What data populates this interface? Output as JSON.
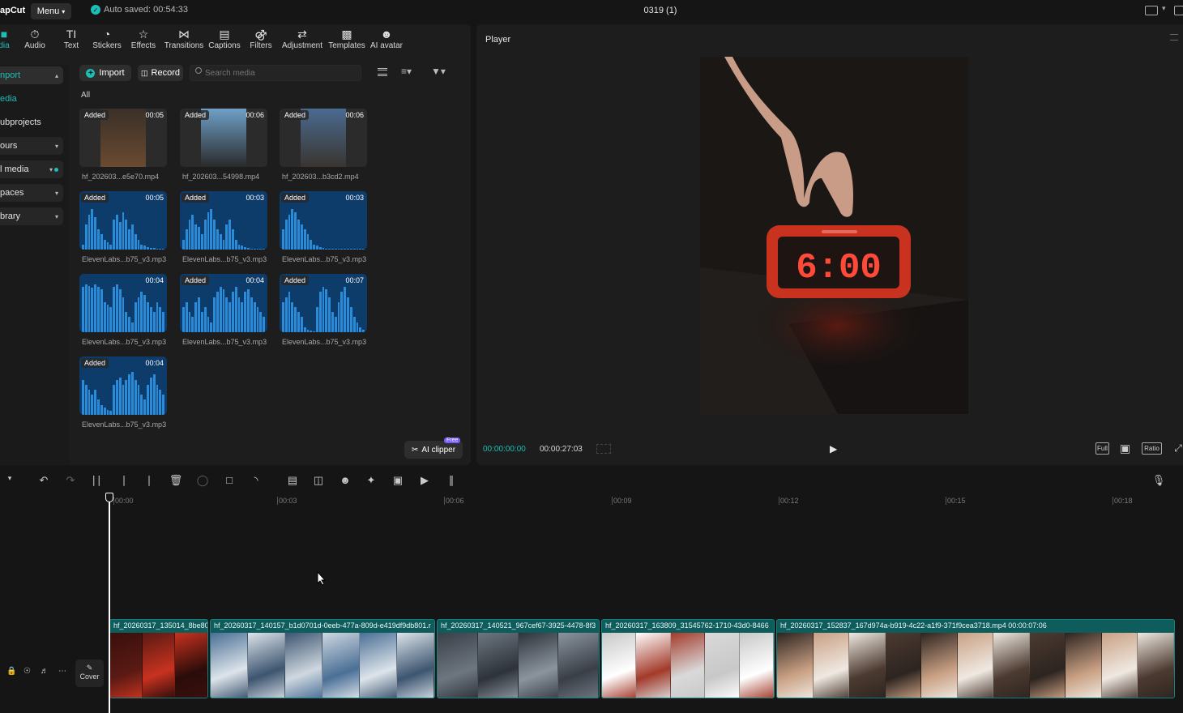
{
  "topbar": {
    "logo": "apCut",
    "menu": "Menu",
    "autosave": "Auto saved: 00:54:33",
    "project": "0319 (1)"
  },
  "tools": [
    {
      "label": "dia",
      "icon": "media-icon"
    },
    {
      "label": "Audio",
      "icon": "audio-icon"
    },
    {
      "label": "Text",
      "icon": "text-icon"
    },
    {
      "label": "Stickers",
      "icon": "stickers-icon"
    },
    {
      "label": "Effects",
      "icon": "effects-icon"
    },
    {
      "label": "Transitions",
      "icon": "transitions-icon"
    },
    {
      "label": "Captions",
      "icon": "captions-icon"
    },
    {
      "label": "Filters",
      "icon": "filters-icon"
    },
    {
      "label": "Adjustment",
      "icon": "adjustment-icon"
    },
    {
      "label": "Templates",
      "icon": "templates-icon"
    },
    {
      "label": "AI avatar",
      "icon": "ai-avatar-icon"
    }
  ],
  "sidebar": {
    "items": [
      {
        "label": "nport"
      },
      {
        "label": "edia"
      },
      {
        "label": "ubprojects"
      },
      {
        "label": "ours"
      },
      {
        "label": "l media"
      },
      {
        "label": "paces"
      },
      {
        "label": "brary"
      }
    ]
  },
  "media": {
    "import": "Import",
    "record": "Record",
    "search_placeholder": "Search media",
    "all": "All",
    "ai_clipper": "AI clipper",
    "free": "Free",
    "items": [
      {
        "badge": "Added",
        "duration": "00:05",
        "name": "hf_202603...e5e70.mp4",
        "kind": "video"
      },
      {
        "badge": "Added",
        "duration": "00:06",
        "name": "hf_202603...54998.mp4",
        "kind": "video"
      },
      {
        "badge": "Added",
        "duration": "00:06",
        "name": "hf_202603...b3cd2.mp4",
        "kind": "video"
      },
      {
        "badge": "Added",
        "duration": "00:05",
        "name": "ElevenLabs...b75_v3.mp3",
        "kind": "audio"
      },
      {
        "badge": "Added",
        "duration": "00:03",
        "name": "ElevenLabs...b75_v3.mp3",
        "kind": "audio"
      },
      {
        "badge": "Added",
        "duration": "00:03",
        "name": "ElevenLabs...b75_v3.mp3",
        "kind": "audio"
      },
      {
        "badge": "",
        "duration": "00:04",
        "name": "ElevenLabs...b75_v3.mp3",
        "kind": "audio"
      },
      {
        "badge": "Added",
        "duration": "00:04",
        "name": "ElevenLabs...b75_v3.mp3",
        "kind": "audio"
      },
      {
        "badge": "Added",
        "duration": "00:07",
        "name": "ElevenLabs...b75_v3.mp3",
        "kind": "audio"
      },
      {
        "badge": "Added",
        "duration": "00:04",
        "name": "ElevenLabs...b75_v3.mp3",
        "kind": "audio"
      }
    ]
  },
  "player": {
    "title": "Player",
    "current_time": "00:00:00:00",
    "total_time": "00:00:27:03",
    "preview_clock": "6:00",
    "buttons": [
      "Full",
      "Ratio"
    ]
  },
  "timeline": {
    "ticks": [
      "00:00",
      "00:03",
      "00:06",
      "00:09",
      "00:12",
      "00:15",
      "00:18"
    ],
    "cover": "Cover",
    "clips": [
      {
        "label": "hf_20260317_135014_8be80"
      },
      {
        "label": "hf_20260317_140157_b1d0701d-0eeb-477a-809d-e419df9db801.r"
      },
      {
        "label": "hf_20260317_140521_967cef67-3925-4478-8f3"
      },
      {
        "label": "hf_20260317_163809_31545762-1710-43d0-8466"
      },
      {
        "label": "hf_20260317_152837_167d974a-b919-4c22-a1f9-371f9cea3718.mp4   00:00:07:06"
      }
    ]
  },
  "colors": {
    "accent": "#1ebdb6",
    "clip": "#0f5c5c",
    "audio_thumb": "#0d3b6a",
    "wave": "#2a8bd8"
  }
}
